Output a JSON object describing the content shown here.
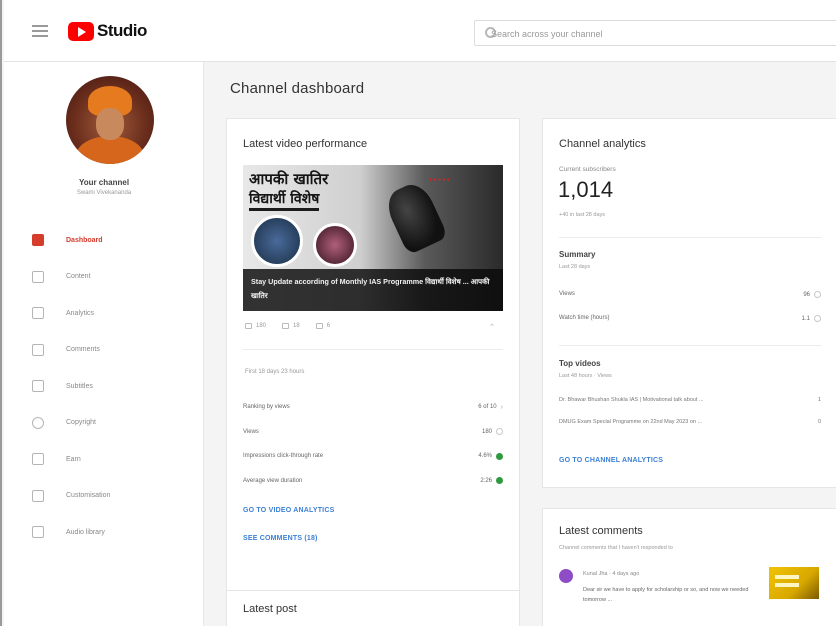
{
  "header": {
    "brand": "Studio",
    "search_placeholder": "Search across your channel"
  },
  "sidebar": {
    "channel_name": "Your channel",
    "channel_subtitle": "Swami Vivekananda",
    "items": [
      {
        "label": "Dashboard",
        "icon": "dashboard-icon",
        "active": true
      },
      {
        "label": "Content",
        "icon": "content-icon",
        "active": false
      },
      {
        "label": "Analytics",
        "icon": "analytics-icon",
        "active": false
      },
      {
        "label": "Comments",
        "icon": "comments-icon",
        "active": false
      },
      {
        "label": "Subtitles",
        "icon": "subtitles-icon",
        "active": false
      },
      {
        "label": "Copyright",
        "icon": "copyright-icon",
        "active": false
      },
      {
        "label": "Earn",
        "icon": "earn-icon",
        "active": false
      },
      {
        "label": "Customisation",
        "icon": "customisation-icon",
        "active": false
      },
      {
        "label": "Audio library",
        "icon": "audio-library-icon",
        "active": false
      }
    ],
    "accent_color": "#d43c2b"
  },
  "main": {
    "page_title": "Channel dashboard",
    "latest_video": {
      "title": "Latest video performance",
      "thumbnail": {
        "heading_line1": "आपकी खातिर",
        "heading_line2": "विद्यार्थी विशेष",
        "caption": "Stay Update according of Monthly IAS Programme विद्यार्थी विशेष ... आपकी खातिर"
      },
      "stats": {
        "views": "180",
        "comments": "18",
        "likes": "6"
      },
      "first_period": "First 18 days 23 hours",
      "metrics": [
        {
          "label": "Ranking by views",
          "value": "6 of 10",
          "indicator": "none"
        },
        {
          "label": "Views",
          "value": "180",
          "indicator": "grey"
        },
        {
          "label": "Impressions click-through rate",
          "value": "4.6%",
          "indicator": "green"
        },
        {
          "label": "Average view duration",
          "value": "2:26",
          "indicator": "green"
        }
      ],
      "link_analytics": "GO TO VIDEO ANALYTICS",
      "link_comments": "SEE COMMENTS (18)"
    },
    "latest_post": {
      "title": "Latest post"
    },
    "channel_analytics": {
      "title": "Channel analytics",
      "subscribers_label": "Current subscribers",
      "subscribers_count": "1,014",
      "subscribers_change": "+40 in last 28 days",
      "summary_title": "Summary",
      "summary_period": "Last 28 days",
      "summary": [
        {
          "label": "Views",
          "value": "96"
        },
        {
          "label": "Watch time (hours)",
          "value": "1.1"
        }
      ],
      "top_videos_title": "Top videos",
      "top_videos_period": "Last 48 hours · Views",
      "top_videos": [
        {
          "title": "Dr. Bhawar Bhushan Shukla IAS | Motivational talk about ...",
          "views": "1"
        },
        {
          "title": "DMUG Exam Special Programme on 22nd May 2023 on ...",
          "views": "0"
        }
      ],
      "link": "GO TO CHANNEL ANALYTICS"
    },
    "latest_comments": {
      "title": "Latest comments",
      "subtitle": "Channel comments that I haven't responded to",
      "comment_meta": "Kunal Jha · 4 days ago",
      "comment_text": "Dear sir we have to apply for scholarship or so, and now we needed tomorrow ..."
    },
    "status_colors": {
      "good": "#2e9a40",
      "link": "#3b7fd6"
    }
  }
}
